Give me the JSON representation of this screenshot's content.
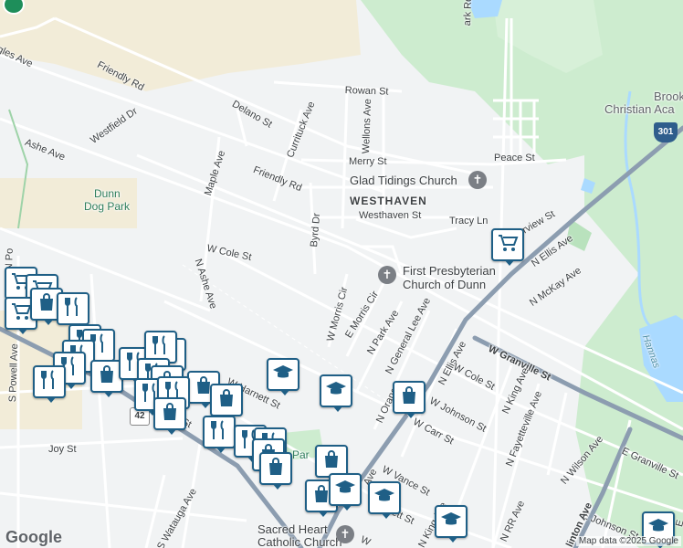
{
  "map": {
    "attribution": "Map data ©2025 Google",
    "logo": "Google",
    "colors": {
      "land": "#f1f3f4",
      "park": "#cdeccf",
      "water": "#aadaff",
      "sand": "#f2ecd8",
      "road": "#ffffff",
      "highway": "#8c9db0",
      "pin_border": "#1f5f86"
    }
  },
  "labels": {
    "glad_tidings": "Glad Tidings Church",
    "westhaven": "WESTHAVEN",
    "first_presby_1": "First Presbyterian",
    "first_presby_2": "Church of Dunn",
    "sacred_heart_1": "Sacred Heart",
    "sacred_heart_2": "Catholic Church",
    "dunn_dog_park_1": "Dunn",
    "dunn_dog_park_2": "Dog Park",
    "brook_1": "Brook",
    "brook_2": "Christian Aca",
    "hannas": "Hannas",
    "park": "Par",
    "friendly_rd_1": "Friendly Rd",
    "friendly_rd_2": "Friendly Rd",
    "rowan": "Rowan St",
    "delano": "Delano St",
    "currituck": "Currituck Ave",
    "wellons": "Wellons Ave",
    "merry": "Merry St",
    "peace": "Peace St",
    "westfield": "Westfield Dr",
    "ashe_ave": "Ashe Ave",
    "maple": "Maple Ave",
    "byrd": "Byrd Dr",
    "westhaven_st": "Westhaven St",
    "tracy": "Tracy Ln",
    "fairview": "rview St",
    "n_ellis_ave_1": "N Ellis Ave",
    "w_cole_st": "W Cole St",
    "n_ashe_ave": "N Ashe Ave",
    "w_morris_cir": "W Morris Cir",
    "e_morris_cir": "E Morris Cir",
    "n_park_ave": "N Park Ave",
    "n_general_lee": "N General Lee Ave",
    "n_ellis_ave_2": "N Ellis Ave",
    "n_mckay": "N McKay Ave",
    "w_granville": "W Granville St",
    "w_cole_st_2": "W Cole St",
    "n_king_ave": "N King Ave",
    "w_johnson": "W Johnson St",
    "n_fayetteville": "N Fayetteville Ave",
    "w_carr": "W Carr St",
    "n_orange": "N Orang",
    "w_harnett": "W Harnett St",
    "w_vance": "W Vance St",
    "s_powell": "S Powell Ave",
    "joy_st": "Joy St",
    "s_watauga": "S Watauga Ave",
    "n_wilson": "N Wilson Ave",
    "e_granville": "E Granville St",
    "e_johnson": "E Johnson St",
    "n_rr": "N RR Ave",
    "clinton": "linton Ave",
    "n_king_2": "N King Ave",
    "angles": "gles Ave",
    "n_powell": "N Po",
    "park_rd": "ark Rd",
    "e_letter": "E",
    "route_301": "301",
    "route_42": "42",
    "w_st_bottom": "W",
    "ett_st": "ett St",
    "st_frag": "St",
    "ave_frag": "Ave"
  },
  "icons": {
    "pin_types": [
      "grocery-icon",
      "restaurant-icon",
      "shopping-bag-icon",
      "school-icon"
    ],
    "church": "cross-icon"
  }
}
